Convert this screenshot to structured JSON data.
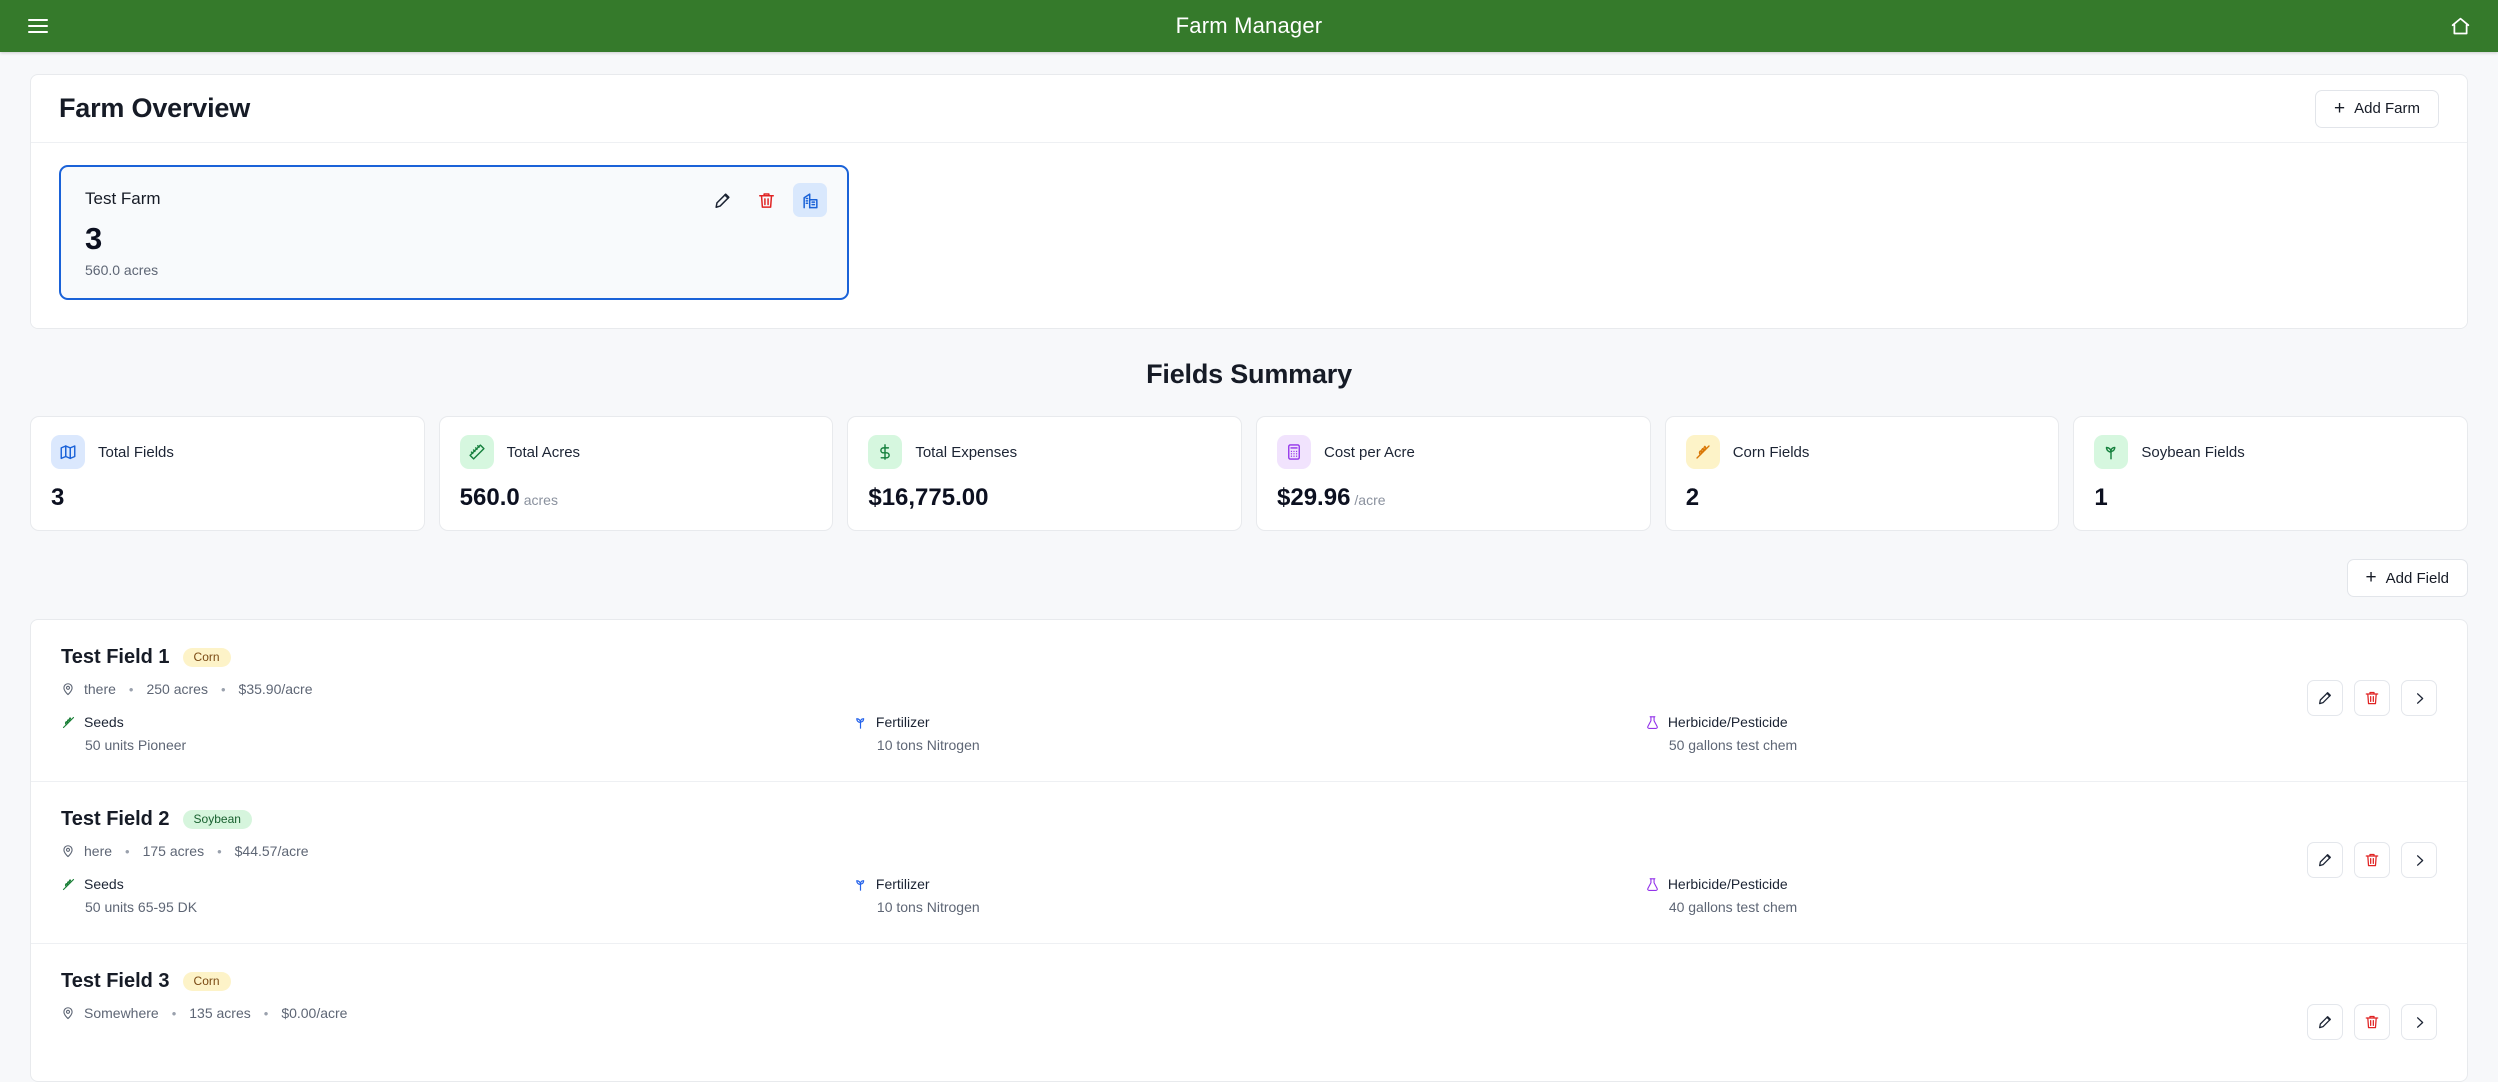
{
  "app": {
    "title": "Farm Manager",
    "menu_icon": "hamburger-menu-icon",
    "home_icon": "home-icon",
    "header_color": "#357a2b"
  },
  "overview": {
    "title": "Farm Overview",
    "add_farm_label": "Add Farm",
    "farm": {
      "name": "Test Farm",
      "field_count": "3",
      "acres": "560.0 acres",
      "selected": true,
      "actions": [
        {
          "name": "edit-farm-button",
          "icon": "pencil-icon",
          "color": "#1c2434"
        },
        {
          "name": "delete-farm-button",
          "icon": "trash-icon",
          "color": "#e02424"
        },
        {
          "name": "view-farm-button",
          "icon": "building-icon",
          "color": "#1a62d8",
          "active": true
        }
      ]
    }
  },
  "summary": {
    "title": "Fields Summary",
    "stats": [
      {
        "label": "Total Fields",
        "value": "3",
        "unit": "",
        "icon": "map-icon",
        "icon_color": "#1a62d8",
        "icon_bg": "#dbe8fd"
      },
      {
        "label": "Total Acres",
        "value": "560.0",
        "unit": "acres",
        "icon": "ruler-icon",
        "icon_color": "#15803d",
        "icon_bg": "#d6f7df"
      },
      {
        "label": "Total Expenses",
        "value": "$16,775.00",
        "unit": "",
        "icon": "dollar-icon",
        "icon_color": "#15803d",
        "icon_bg": "#d6f7df"
      },
      {
        "label": "Cost per Acre",
        "value": "$29.96",
        "unit": "/acre",
        "icon": "calculator-icon",
        "icon_color": "#9333ea",
        "icon_bg": "#f1e3fd"
      },
      {
        "label": "Corn Fields",
        "value": "2",
        "unit": "",
        "icon": "wheat-icon",
        "icon_color": "#d97706",
        "icon_bg": "#fdf3c8"
      },
      {
        "label": "Soybean Fields",
        "value": "1",
        "unit": "",
        "icon": "sprout-icon",
        "icon_color": "#15803d",
        "icon_bg": "#d6f7df"
      }
    ]
  },
  "fields_section": {
    "add_field_label": "Add Field",
    "rows": [
      {
        "name": "Test Field 1",
        "badge": "Corn",
        "badge_type": "corn",
        "location": "there",
        "acres": "250 acres",
        "cost": "$35.90/acre",
        "inputs": [
          {
            "label": "Seeds",
            "value": "50 units Pioneer",
            "icon": "wheat-icon",
            "icon_color": "#1a7f37"
          },
          {
            "label": "Fertilizer",
            "value": "10 tons Nitrogen",
            "icon": "sprout-icon",
            "icon_color": "#2563eb"
          },
          {
            "label": "Herbicide/Pesticide",
            "value": "50 gallons test chem",
            "icon": "flask-icon",
            "icon_color": "#9333ea"
          }
        ],
        "actions": [
          {
            "name": "edit-field-button",
            "icon": "pencil-icon"
          },
          {
            "name": "delete-field-button",
            "icon": "trash-icon"
          },
          {
            "name": "open-field-button",
            "icon": "chevron-right-icon"
          }
        ]
      },
      {
        "name": "Test Field 2",
        "badge": "Soybean",
        "badge_type": "soybean",
        "location": "here",
        "acres": "175 acres",
        "cost": "$44.57/acre",
        "inputs": [
          {
            "label": "Seeds",
            "value": "50 units 65-95 DK",
            "icon": "wheat-icon",
            "icon_color": "#1a7f37"
          },
          {
            "label": "Fertilizer",
            "value": "10 tons Nitrogen",
            "icon": "sprout-icon",
            "icon_color": "#2563eb"
          },
          {
            "label": "Herbicide/Pesticide",
            "value": "40 gallons test chem",
            "icon": "flask-icon",
            "icon_color": "#9333ea"
          }
        ],
        "actions": [
          {
            "name": "edit-field-button",
            "icon": "pencil-icon"
          },
          {
            "name": "delete-field-button",
            "icon": "trash-icon"
          },
          {
            "name": "open-field-button",
            "icon": "chevron-right-icon"
          }
        ]
      },
      {
        "name": "Test Field 3",
        "badge": "Corn",
        "badge_type": "corn",
        "location": "Somewhere",
        "acres": "135 acres",
        "cost": "$0.00/acre",
        "inputs": [],
        "actions": [
          {
            "name": "edit-field-button",
            "icon": "pencil-icon"
          },
          {
            "name": "delete-field-button",
            "icon": "trash-icon"
          },
          {
            "name": "open-field-button",
            "icon": "chevron-right-icon"
          }
        ]
      }
    ]
  }
}
